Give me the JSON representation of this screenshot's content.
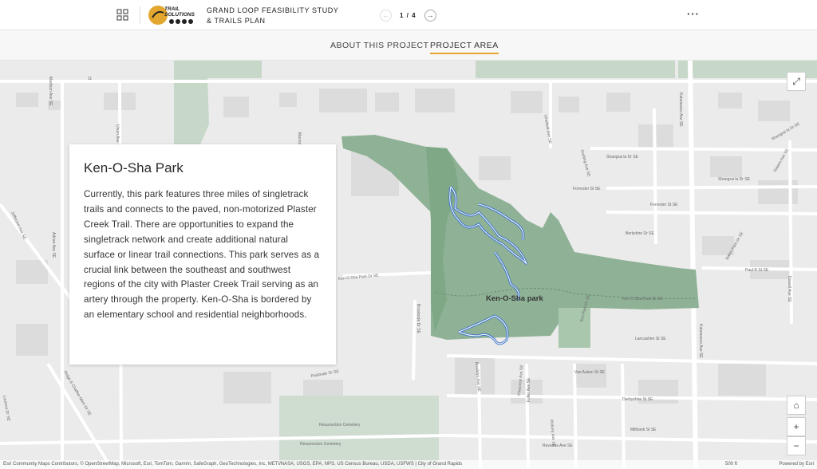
{
  "header": {
    "title": "GRAND LOOP FEASIBILITY STUDY & TRAILS PLAN",
    "logo_text": "TRAIL SOLUTIONS",
    "page_indicator": "1 / 4",
    "more_label": "···"
  },
  "tabs": [
    {
      "label": "ABOUT THIS PROJECT",
      "active": false
    },
    {
      "label": "PROJECT AREA",
      "active": true
    }
  ],
  "panel": {
    "title": "Ken-O-Sha Park",
    "body": "Currently, this park features three miles of singletrack trails and connects to the paved, non-motorized Plaster Creek Trail. There are opportunities to expand the singletrack network and create additional natural surface or linear trail connections. This park serves as a crucial link between the southeast and southwest regions of the city with Plaster Creek Trail serving as an artery through the property. Ken-O-Sha is bordered by an elementary school and residential neighborhoods."
  },
  "map": {
    "park_label": "Ken-O-Sha park",
    "street_labels": {
      "kalamazoo_top": "Kalamazoo Ave SE",
      "kalamazoo_bottom": "Kalamazoo Ave SE",
      "madison": "Madison Ave SE",
      "union": "Union Ave SE",
      "marion": "Marion",
      "adrian": "Adrian Ave SE",
      "jefferson": "Jefferson Ave SE",
      "shangrai_la": "Shangrai la Dr SE",
      "shangrai_la_2": "Shangrai la Dr SE",
      "forrester": "Forrester St SE",
      "forrester_2": "Forrester St SE",
      "berkshire": "Berkshire Dr SE",
      "golding": "Golding Ave SE",
      "paul_r": "Paul R St SE",
      "dowell": "Dowell Ave SE",
      "baker_park": "Baker Park Dr SE",
      "dawes": "Dawes Ave SE",
      "shangrai_la_top": "Shangrai la Dr SE",
      "ken_o_sha_park_dr": "Ken O Sha Park Dr SE",
      "ken_o_sha_park_dr_2": "Ken O Sha Park Dr SE",
      "lancashire": "Lancashire St SE",
      "vanauken": "Van Auken St SE",
      "vanauken_2": "Van Auken St SE",
      "brookside": "Brookside Dr SE",
      "brooklyn": "Brooklyn Ave SE",
      "fuller": "Fuller Ave SE",
      "pinecrest": "Pinecrest Ave SE",
      "hickory": "Hickory Ave SE",
      "ravanna": "Ravanna Ave SE",
      "derbyshire": "Derbyshire St SE",
      "millbank": "Millbank St SE",
      "paisbode": "Paisbode Dr SE",
      "ridge_chaffee": "Ridge & Chaffee Mem Dr SE",
      "lousma": "Lousma Dr SE",
      "cemetery": "Resurrection Cemetery",
      "cemetery_2": "Resurrection Cemetery",
      "vinefield": "Vinefield Ave SE",
      "seminary": "Sun Park Dr SE",
      "route": "11"
    },
    "attribution": "Esri Community Maps Contributors, © OpenStreetMap, Microsoft, Esri, TomTom, Garmin, SafeGraph, GeoTechnologies, Inc, METI/NASA, USGS, EPA, NPS, US Census Bureau, USDA, USFWS | City of Grand Rapids",
    "powered_by": "Powered by Esri",
    "scale_label": "500 ft",
    "controls": {
      "expand": "⤢",
      "home": "⌂",
      "zoom_in": "+",
      "zoom_out": "−"
    }
  },
  "colors": {
    "accent": "#e3a72f",
    "park_green": "#8fb296",
    "trail_blue": "#3c73c9"
  }
}
